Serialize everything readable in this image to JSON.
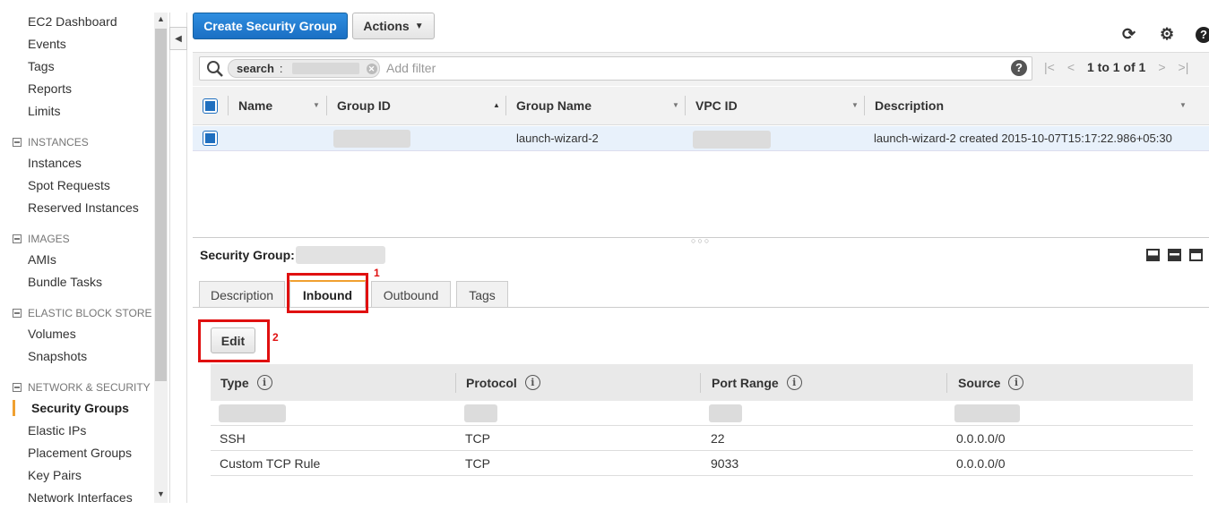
{
  "sidebar": {
    "top_items": [
      "EC2 Dashboard",
      "Events",
      "Tags",
      "Reports",
      "Limits"
    ],
    "sections": [
      {
        "title": "INSTANCES",
        "items": [
          "Instances",
          "Spot Requests",
          "Reserved Instances"
        ]
      },
      {
        "title": "IMAGES",
        "items": [
          "AMIs",
          "Bundle Tasks"
        ]
      },
      {
        "title": "ELASTIC BLOCK STORE",
        "items": [
          "Volumes",
          "Snapshots"
        ]
      },
      {
        "title": "NETWORK & SECURITY",
        "items": [
          "Security Groups",
          "Elastic IPs",
          "Placement Groups",
          "Key Pairs",
          "Network Interfaces"
        ]
      }
    ],
    "active_item": "Security Groups"
  },
  "toolbar": {
    "create_label": "Create Security Group",
    "actions_label": "Actions",
    "refresh_icon": "refresh-icon",
    "settings_icon": "gear-icon",
    "help_icon": "help-icon"
  },
  "filter": {
    "tag_key": "search",
    "tag_sep": ":",
    "placeholder": "Add filter",
    "pager_text": "1 to 1 of 1"
  },
  "grid": {
    "columns": [
      "Name",
      "Group ID",
      "Group Name",
      "VPC ID",
      "Description"
    ],
    "rows": [
      {
        "name": "",
        "group_id": "",
        "group_name": "launch-wizard-2",
        "vpc_id": "",
        "description": "launch-wizard-2 created 2015-10-07T15:17:22.986+05:30"
      }
    ]
  },
  "detail": {
    "label": "Security Group:",
    "tabs": [
      "Description",
      "Inbound",
      "Outbound",
      "Tags"
    ],
    "active_tab": "Inbound",
    "edit_label": "Edit",
    "annotations": [
      "1",
      "2"
    ],
    "rules_columns": [
      "Type",
      "Protocol",
      "Port Range",
      "Source"
    ],
    "info_glyph": "i",
    "rules": [
      {
        "type": "SSH",
        "protocol": "TCP",
        "port": "22",
        "source": "0.0.0.0/0"
      },
      {
        "type": "Custom TCP Rule",
        "protocol": "TCP",
        "port": "9033",
        "source": "0.0.0.0/0"
      }
    ]
  },
  "colors": {
    "primary": "#1a6fc4",
    "accent": "#f0a030",
    "highlight": "#e01010"
  }
}
